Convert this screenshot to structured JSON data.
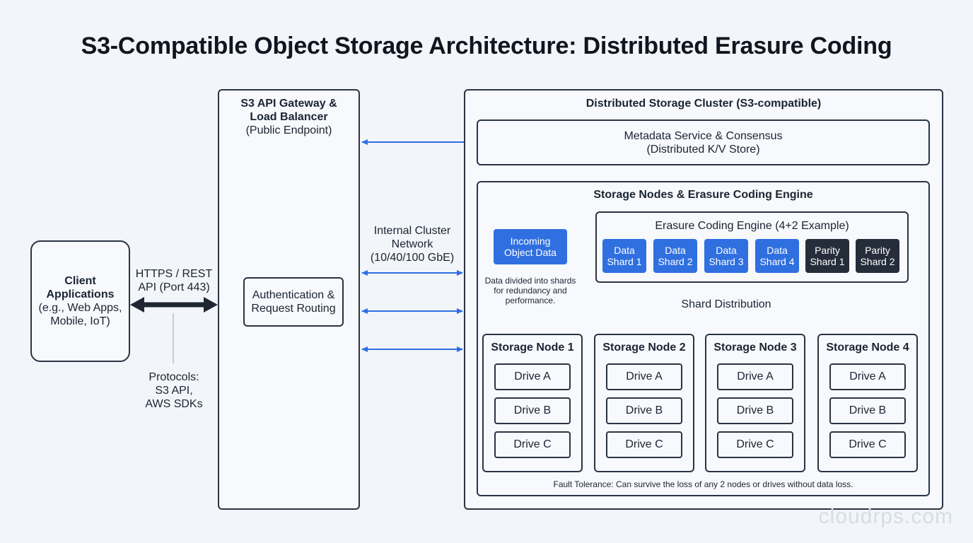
{
  "title": "S3-Compatible Object Storage Architecture: Distributed Erasure Coding",
  "client": {
    "title_line1": "Client",
    "title_line2": "Applications",
    "sub_line1": "(e.g., Web Apps,",
    "sub_line2": "Mobile, IoT)"
  },
  "https": {
    "line1": "HTTPS / REST",
    "line2": "API (Port 443)"
  },
  "protocols": {
    "line1": "Protocols:",
    "line2": "S3 API,",
    "line3": "AWS SDKs"
  },
  "gateway": {
    "title_line1": "S3 API Gateway &",
    "title_line2": "Load Balancer",
    "sub": "(Public Endpoint)",
    "auth_line1": "Authentication &",
    "auth_line2": "Request Routing"
  },
  "network": {
    "line1": "Internal Cluster",
    "line2": "Network",
    "line3": "(10/40/100 GbE)"
  },
  "cluster": {
    "title": "Distributed Storage Cluster (S3-compatible)"
  },
  "metadata": {
    "line1": "Metadata Service & Consensus",
    "line2": "(Distributed K/V Store)"
  },
  "storage_engine": {
    "title": "Storage Nodes & Erasure Coding Engine"
  },
  "incoming": {
    "line1": "Incoming",
    "line2": "Object Data",
    "note_line1": "Data divided into shards",
    "note_line2": "for redundancy and",
    "note_line3": "performance."
  },
  "ec_engine": {
    "title": "Erasure Coding Engine (4+2 Example)",
    "shards": [
      {
        "line1": "Data",
        "line2": "Shard 1",
        "kind": "data"
      },
      {
        "line1": "Data",
        "line2": "Shard 2",
        "kind": "data"
      },
      {
        "line1": "Data",
        "line2": "Shard 3",
        "kind": "data"
      },
      {
        "line1": "Data",
        "line2": "Shard 4",
        "kind": "data"
      },
      {
        "line1": "Parity",
        "line2": "Shard 1",
        "kind": "parity"
      },
      {
        "line1": "Parity",
        "line2": "Shard 2",
        "kind": "parity"
      }
    ]
  },
  "shard_distribution": "Shard Distribution",
  "nodes": [
    {
      "title": "Storage Node 1",
      "drives": [
        "Drive A",
        "Drive B",
        "Drive C"
      ]
    },
    {
      "title": "Storage Node 2",
      "drives": [
        "Drive A",
        "Drive B",
        "Drive C"
      ]
    },
    {
      "title": "Storage Node 3",
      "drives": [
        "Drive A",
        "Drive B",
        "Drive C"
      ]
    },
    {
      "title": "Storage Node 4",
      "drives": [
        "Drive A",
        "Drive B",
        "Drive C"
      ]
    }
  ],
  "fault_tolerance": "Fault Tolerance: Can survive the loss of any 2 nodes or drives without data loss.",
  "watermark": "cloudrps.com",
  "colors": {
    "blue": "#2f6fe0",
    "dark": "#252c3a",
    "border": "#2b3444",
    "background": "#f2f5f9"
  }
}
